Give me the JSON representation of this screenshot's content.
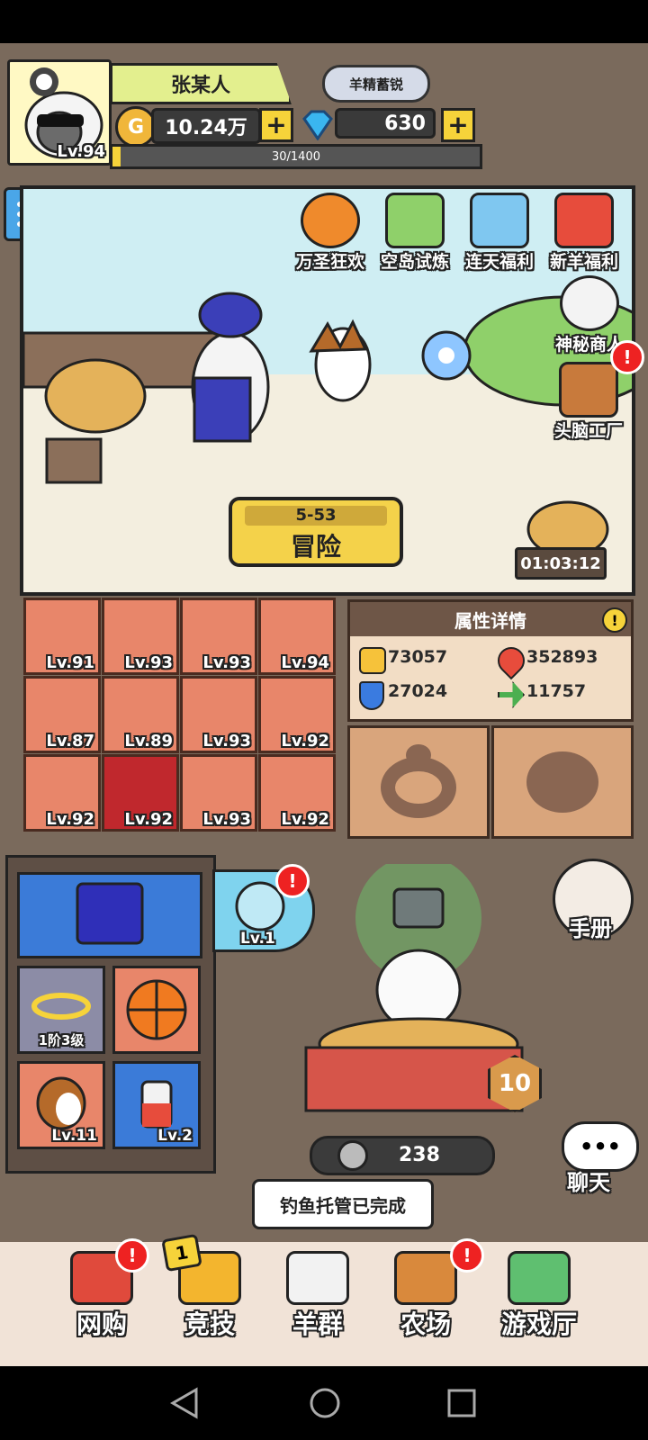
{
  "player": {
    "name": "张某人",
    "level": "Lv.94",
    "title": "羊精蓄锐"
  },
  "resources": {
    "gold": "10.24万",
    "gems": "630"
  },
  "xp": {
    "text": "30/1400",
    "progress": 0.0214
  },
  "events": [
    {
      "label": "万圣狂欢",
      "icon": "pumpkin-icon"
    },
    {
      "label": "空岛试炼",
      "icon": "island-icon"
    },
    {
      "label": "连天福利",
      "icon": "gift-box-icon"
    },
    {
      "label": "新羊福利",
      "icon": "present-icon"
    }
  ],
  "side_events": [
    {
      "label": "神秘商人",
      "icon": "merchant-icon"
    },
    {
      "label": "头脑工厂",
      "icon": "brain-factory-icon"
    }
  ],
  "adventure": {
    "stage": "5-53",
    "label": "冒险"
  },
  "timer": "01:03:12",
  "gear": [
    {
      "level": "Lv.91",
      "color": "#e8866a"
    },
    {
      "level": "Lv.93",
      "color": "#e8866a"
    },
    {
      "level": "Lv.93",
      "color": "#e8866a"
    },
    {
      "level": "Lv.94",
      "color": "#e8866a"
    },
    {
      "level": "Lv.87",
      "color": "#e8866a"
    },
    {
      "level": "Lv.89",
      "color": "#e8866a"
    },
    {
      "level": "Lv.93",
      "color": "#e8866a"
    },
    {
      "level": "Lv.92",
      "color": "#e8866a"
    },
    {
      "level": "Lv.92",
      "color": "#e8866a"
    },
    {
      "level": "Lv.92",
      "color": "#c0282d"
    },
    {
      "level": "Lv.93",
      "color": "#e8866a"
    },
    {
      "level": "Lv.92",
      "color": "#e8866a"
    }
  ],
  "attributes": {
    "title": "属性详情",
    "attack": "73057",
    "hp": "352893",
    "defense": "27024",
    "speed": "11757"
  },
  "inventory": {
    "fishbowl_level": "Lv.1",
    "item_rank": "1阶3级",
    "pet_level": "Lv.11",
    "bottle_level": "Lv.2"
  },
  "farm": {
    "level_badge": "10",
    "count": "238"
  },
  "manual_label": "手册",
  "chat_label": "聊天",
  "notice": "钓鱼托管已完成",
  "nav": [
    {
      "label": "网购",
      "icon": "shopping-basket-icon"
    },
    {
      "label": "竞技",
      "icon": "trophy-icon"
    },
    {
      "label": "羊群",
      "icon": "flock-icon"
    },
    {
      "label": "农场",
      "icon": "barn-icon"
    },
    {
      "label": "游戏厅",
      "icon": "arcade-icon"
    }
  ],
  "nav_badge": "1",
  "colors": {
    "accent": "#f6d33a",
    "panel": "#e8866a",
    "alert": "#e22222"
  }
}
